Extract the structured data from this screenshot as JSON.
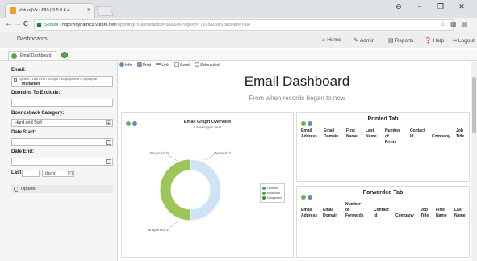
{
  "browser": {
    "tab_title": "Vuture|Vx | 680 | 9.5.0.6.4",
    "tab_close": "×",
    "window_buttons": [
      "⊖",
      "−",
      "❐",
      "✕"
    ],
    "url_secure_label": "Secure",
    "url_host": "https://dynamics.vuture.net",
    "url_path": "/reporting/?DashboardId=38&SitePageId=77108&useSpacelab=True",
    "back_icon": "←",
    "forward_icon": "→",
    "reload_icon": "C"
  },
  "header": {
    "title": "Dashboards",
    "nav": [
      {
        "icon": "home-icon",
        "label": "Home"
      },
      {
        "icon": "admin-icon",
        "label": "Admin"
      },
      {
        "icon": "reports-icon",
        "label": "Reports"
      },
      {
        "icon": "help-icon",
        "label": "Help"
      },
      {
        "icon": "logout-icon",
        "label": "Logout"
      }
    ]
  },
  "dashboard_tabs": {
    "active": "Email Dashboard"
  },
  "sidebar": {
    "email_label": "Email:",
    "email_value_line1": "System / Law Firm / Europe / Employment / Employme",
    "email_value_line2": "Invitation",
    "domains_label": "Domains To Exclude:",
    "domains_value": "",
    "bounceback_label": "Bounceback Category:",
    "bounceback_value": "Hard and Soft",
    "date_start_label": "Date Start:",
    "date_end_label": "Date End:",
    "last_label": "Last",
    "last_value": "",
    "last_unit": "day(s)",
    "update_label": "Update"
  },
  "toolbar": {
    "items": [
      "Info",
      "Print",
      "Link",
      "Send",
      "Scheduled"
    ]
  },
  "main": {
    "title": "Email Dashboard",
    "subtitle": "From when records began to now"
  },
  "graph_panel": {
    "title": "Email Graph Overview",
    "subtitle": "6 Messages Sent",
    "label_bounced": "Bounced: 0",
    "label_opened": "Opened: 2",
    "label_unopened": "Unopened: 2",
    "legend": [
      "Opened",
      "Bounced",
      "Unopened"
    ],
    "colors": {
      "opened": "#cfe3f5",
      "bounced": "#c9c9c9",
      "unopened": "#9cc55a"
    }
  },
  "chart_data": {
    "type": "pie",
    "title": "Email Graph Overview",
    "subtitle": "6 Messages Sent",
    "categories": [
      "Opened",
      "Bounced",
      "Unopened"
    ],
    "values": [
      2,
      0,
      2
    ],
    "legend_position": "right"
  },
  "printed_panel": {
    "title": "Printed Tab",
    "columns": [
      [
        "Email",
        "Address"
      ],
      [
        "Email",
        "Domain"
      ],
      [
        "First",
        "Name"
      ],
      [
        "Last",
        "Name"
      ],
      [
        "Number",
        "of Prints"
      ],
      [
        "Contact",
        "Id"
      ],
      [
        "",
        "Company"
      ],
      [
        "Job",
        "Title"
      ]
    ]
  },
  "forwarded_panel": {
    "title": "Forwarded Tab",
    "columns": [
      [
        "",
        "Email",
        "Address"
      ],
      [
        "",
        "Email",
        "Domain"
      ],
      [
        "Number",
        "of",
        "Forwards"
      ],
      [
        "",
        "Contact",
        "Id"
      ],
      [
        "",
        "",
        "Company"
      ],
      [
        "",
        "Job",
        "Title"
      ],
      [
        "",
        "First",
        "Name"
      ],
      [
        "",
        "Last",
        "Name"
      ]
    ]
  }
}
